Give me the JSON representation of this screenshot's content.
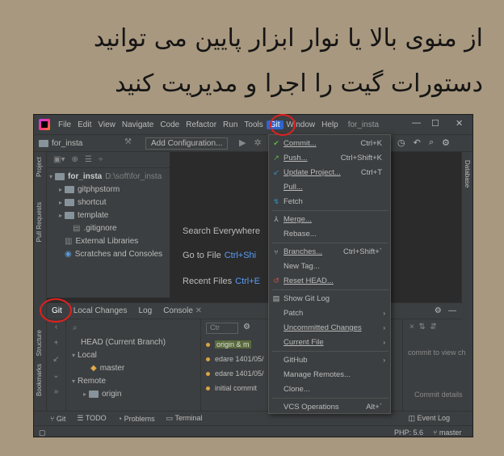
{
  "caption": {
    "line1": "از منوی بالا یا نوار ابزار پایین می توانید",
    "line2": "دستورات گیت را اجرا و مدیریت کنید"
  },
  "menubar": {
    "items": [
      "File",
      "Edit",
      "View",
      "Navigate",
      "Code",
      "Refactor",
      "Run",
      "Tools",
      "Git",
      "Window",
      "Help"
    ],
    "active": "Git",
    "project_title": "for_insta"
  },
  "toolbar": {
    "project_name": "for_insta",
    "add_configuration": "Add Configuration..."
  },
  "left_strip": {
    "project_tab": "Project",
    "pull_requests_tab": "Pull Requests",
    "structure_tab": "Structure",
    "bookmarks_tab": "Bookmarks"
  },
  "right_strip": {
    "database_tab": "Database"
  },
  "project_tree": {
    "root": "for_insta",
    "root_path": "D:\\soft\\for_insta",
    "children": [
      "gitphpstorm",
      "shortcut",
      "template",
      ".gitignore"
    ],
    "external": "External Libraries",
    "scratches": "Scratches and Consoles"
  },
  "welcome": {
    "search": "Search Everywhere",
    "goto_file": "Go to File",
    "goto_file_key": "Ctrl+Shi",
    "recent": "Recent Files",
    "recent_key": "Ctrl+E"
  },
  "git_panel": {
    "tabs": [
      "Git",
      "Local Changes",
      "Log",
      "Console"
    ],
    "branches": {
      "head": "HEAD (Current Branch)",
      "local_label": "Local",
      "local_branch": "master",
      "remote_label": "Remote",
      "remote_branch": "origin"
    },
    "log_filter": "Ctr",
    "log_rows": [
      "origin & m",
      "edare 1401/05/",
      "edare 1401/05/",
      "initial commit"
    ],
    "commit_hint": "commit to view ch",
    "commit_details": "Commit details"
  },
  "git_menu": {
    "commit": "Commit...",
    "commit_key": "Ctrl+K",
    "push": "Push...",
    "push_key": "Ctrl+Shift+K",
    "update": "Update Project...",
    "update_key": "Ctrl+T",
    "pull": "Pull...",
    "fetch": "Fetch",
    "merge": "Merge...",
    "rebase": "Rebase...",
    "branches": "Branches...",
    "branches_key": "Ctrl+Shift+`",
    "new_tag": "New Tag...",
    "reset_head": "Reset HEAD...",
    "show_log": "Show Git Log",
    "patch": "Patch",
    "uncommitted": "Uncommitted Changes",
    "current_file": "Current File",
    "github": "GitHub",
    "manage_remotes": "Manage Remotes...",
    "clone": "Clone...",
    "vcs_ops": "VCS Operations",
    "vcs_key": "Alt+`"
  },
  "bottom_tabs": [
    "Git",
    "TODO",
    "Problems",
    "Terminal"
  ],
  "status": {
    "event_log": "Event Log",
    "php": "PHP: 5.6",
    "branch": "master"
  },
  "colors": {
    "highlight_ring": "#e2201f",
    "menu_active": "#2f65ca",
    "shortcut_blue": "#589df6"
  }
}
